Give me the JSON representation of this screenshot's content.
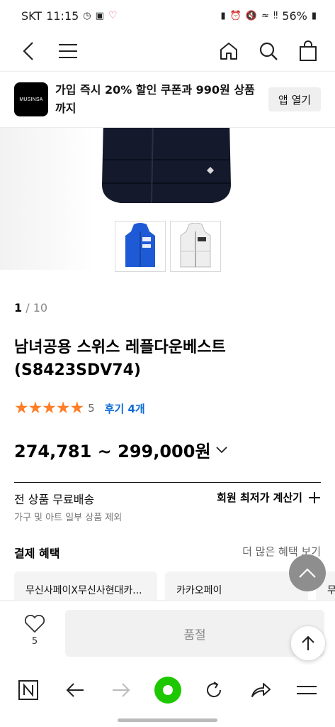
{
  "status_bar": {
    "carrier": "SKT",
    "time": "11:15",
    "battery": "56%"
  },
  "header": {
    "icons": [
      "back-icon",
      "menu-icon",
      "home-icon",
      "search-icon",
      "cart-icon"
    ]
  },
  "promo": {
    "logo_text": "MUSINSA",
    "text": "가입 즉시 20% 할인 쿠폰과 990원 상품까지",
    "button_label": "앱 열기"
  },
  "gallery": {
    "current": "1",
    "separator": " / ",
    "total": "10"
  },
  "product": {
    "title": "남녀공용 스위스 레플다운베스트 (S8423SDV74)",
    "stars": "★★★★★",
    "rating": "5",
    "review_label": "후기 4개",
    "price": "274,781 ~ 299,000원"
  },
  "shipping": {
    "title": "전 상품 무료배송",
    "subtitle": "가구 및 아트 일부 상품 제외",
    "member_price_label": "회원 최저가 계산기"
  },
  "payment": {
    "title": "결제 혜택",
    "more_label": "더 많은 혜택 보기",
    "cards": [
      "무신사페이X무신사현대카...",
      "카카오페이",
      "무"
    ]
  },
  "buy_bar": {
    "like_count": "5",
    "soldout_label": "품절"
  },
  "colors": {
    "star": "#ff7e27",
    "review_link": "#0b6bd8",
    "logo_bg": "#000000",
    "soldout_bg": "#f1f1f1",
    "browser_accent": "#1ec800"
  }
}
